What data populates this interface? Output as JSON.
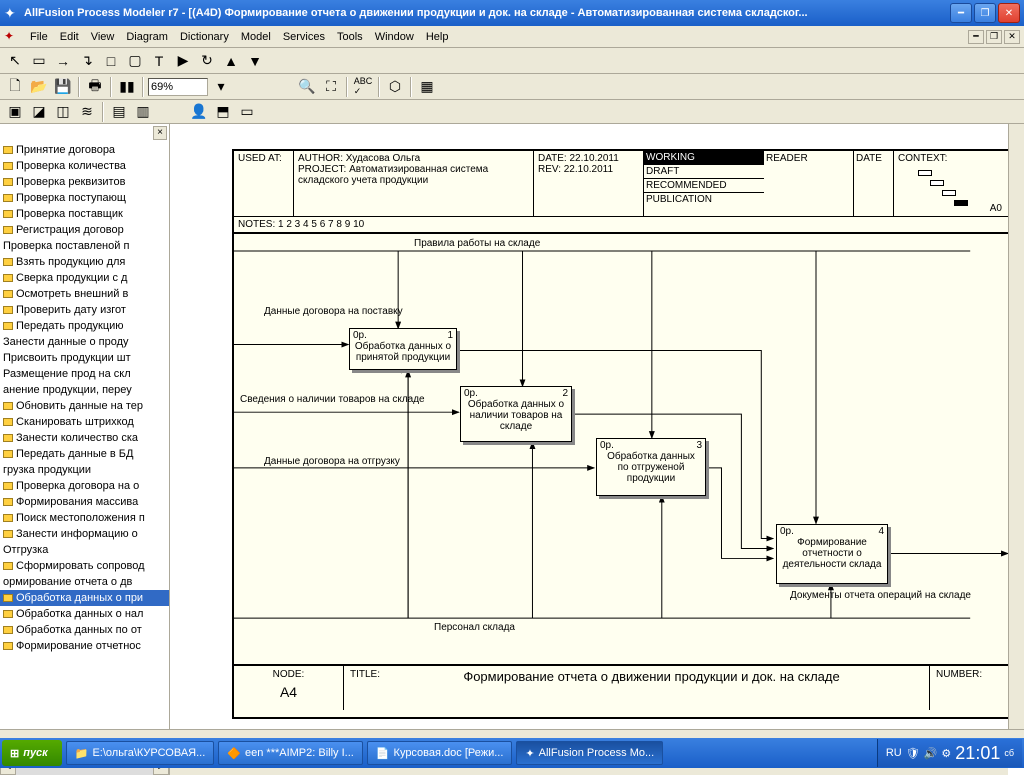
{
  "window": {
    "title": "AllFusion Process Modeler r7 - [(A4D) Формирование отчета о движении продукции и док. на складе - Автоматизированная система складског..."
  },
  "menu": {
    "items": [
      "File",
      "Edit",
      "View",
      "Diagram",
      "Dictionary",
      "Model",
      "Services",
      "Tools",
      "Window",
      "Help"
    ]
  },
  "zoom": "69%",
  "sidebar": {
    "items": [
      "Принятие договора",
      "Проверка количества",
      "Проверка реквизитов",
      "Проверка поступающ",
      "Проверка поставщик",
      "Регистрация договор",
      "Проверка поставленой п",
      "Взять продукцию для",
      "Сверка продукции с д",
      "Осмотреть внешний в",
      "Проверить дату изгот",
      "Передать продукцию",
      "Занести данные о проду",
      "Присвоить продукции шт",
      "Размещение прод на скл",
      "анение продукции, переу",
      "Обновить данные на тер",
      "Сканировать штрихкод",
      "Занести количество ска",
      "Передать данные в БД",
      "грузка продукции",
      "Проверка договора на о",
      "Формирования массива",
      "Поиск местоположения п",
      "Занести информацию о",
      "Отгрузка",
      "Сформировать сопровод",
      "ормирование отчета о дв",
      "Обработка данных о при",
      "Обработка данных о нал",
      "Обработка данных по от",
      "Формирование отчетнос"
    ],
    "selected": 28
  },
  "frame": {
    "usedAt": "USED AT:",
    "author_label": "AUTHOR:",
    "author": "Худасова Ольга",
    "project_label": "PROJECT:",
    "project": "Автоматизированная система складского учета продукции",
    "date_label": "DATE:",
    "date": "22.10.2011",
    "rev_label": "REV:",
    "rev": "22.10.2011",
    "status": [
      "WORKING",
      "DRAFT",
      "RECOMMENDED",
      "PUBLICATION"
    ],
    "reader": "READER",
    "dateCol": "DATE",
    "context": "CONTEXT:",
    "context_node": "A0",
    "notes": "NOTES:  1  2  3  4  5  6  7  8  9  10",
    "node_label": "NODE:",
    "node": "A4",
    "title_label": "TITLE:",
    "title": "Формирование отчета о движении продукции  и док. на складе",
    "number_label": "NUMBER:"
  },
  "diagram": {
    "control": "Правила работы на складе",
    "input1": "Данные договора на поставку",
    "input2": "Сведения о наличии товаров на складе",
    "input3": "Данные договора на отгрузку",
    "mechanism": "Персонал склада",
    "output": "Документы отчета операций на складе",
    "box1": "Обработка данных о принятой продукции",
    "box2": "Обработка данных о наличии товаров на складе",
    "box3": "Обработка данных по отгруженой продукции",
    "box4": "Формирование отчетности о деятельности склада",
    "prefix": "0р.",
    "n1": "1",
    "n2": "2",
    "n3": "3",
    "n4": "4"
  },
  "taskbar": {
    "start": "пуск",
    "items": [
      "E:\\ольга\\КУРСОВАЯ...",
      "een ***AIMP2: Billy I...",
      "Курсовая.doc [Режи...",
      "AllFusion Process Mo..."
    ],
    "lang": "RU",
    "time": "21:01",
    "day": "сб"
  }
}
